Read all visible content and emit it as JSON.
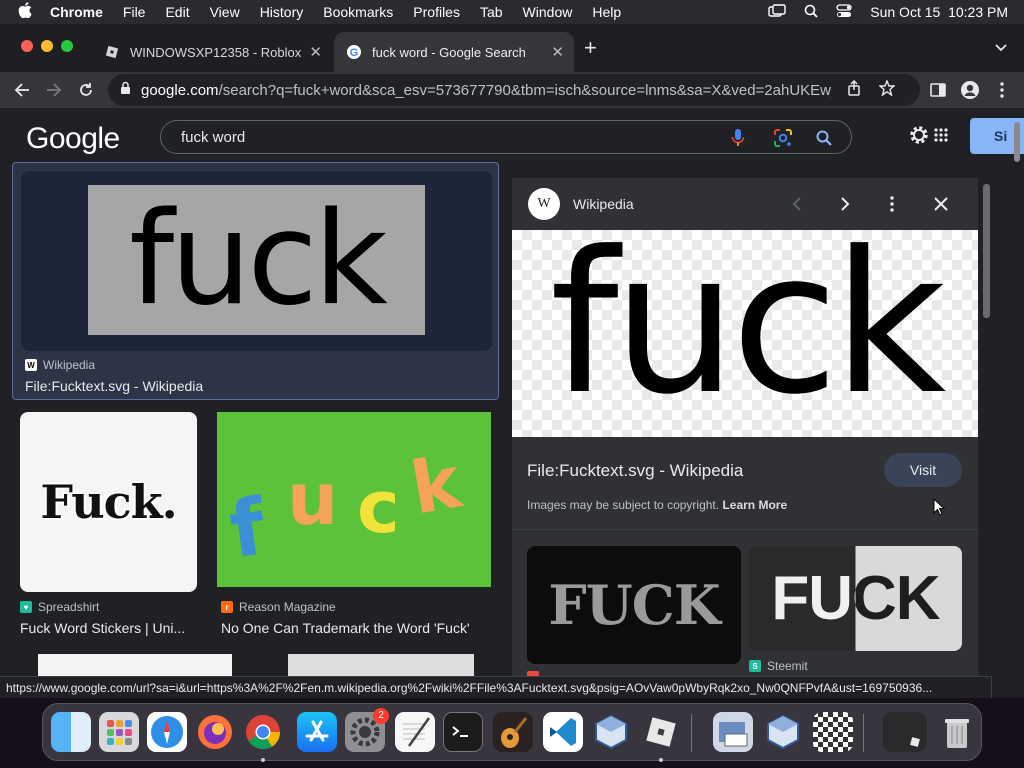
{
  "menubar": {
    "app_name": "Chrome",
    "items": [
      "File",
      "Edit",
      "View",
      "History",
      "Bookmarks",
      "Profiles",
      "Tab",
      "Window",
      "Help"
    ],
    "datetime": "Sun Oct 15  10:23 PM"
  },
  "tabs": [
    {
      "title": "WINDOWSXP12358 - Roblox",
      "active": false
    },
    {
      "title": "fuck word - Google Search",
      "active": true
    }
  ],
  "toolbar": {
    "url_host": "google.com",
    "url_path": "/search?q=fuck+word&sca_esv=573677790&tbm=isch&source=lnms&sa=X&ved=2ahUKEwj..."
  },
  "google": {
    "logo": "Google",
    "query": "fuck word",
    "signin_label": "Si"
  },
  "results": [
    {
      "image_text": "fuck",
      "source": "Wikipedia",
      "title": "File:Fucktext.svg - Wikipedia"
    },
    {
      "image_text": "Fuck.",
      "source": "Spreadshirt",
      "title": "Fuck Word Stickers | Uni..."
    },
    {
      "image_text": "fuck",
      "source": "Reason Magazine",
      "title": "No One Can Trademark the Word 'Fuck'"
    }
  ],
  "panel": {
    "source": "Wikipedia",
    "source_badge": "W",
    "image_text": "fuck",
    "title": "File:Fucktext.svg - Wikipedia",
    "visit_label": "Visit",
    "copyright_text": "Images may be subject to copyright.",
    "learn_more": "Learn More",
    "related": [
      {
        "image_text": "FUCK",
        "source": ""
      },
      {
        "image_text": "FUCK",
        "source": "Steemit"
      }
    ]
  },
  "status_url": "https://www.google.com/url?sa=i&url=https%3A%2F%2Fen.m.wikipedia.org%2Fwiki%2FFile%3AFucktext.svg&psig=AOvVaw0pWbyRqk2xo_Nw0QNFPvfA&ust=169750936...",
  "dock": {
    "settings_badge": "2",
    "apps": [
      "finder-icon",
      "launchpad-icon",
      "safari-icon",
      "firefox-icon",
      "chrome-icon",
      "app-store-icon",
      "system-settings-icon",
      "textedit-icon",
      "terminal-icon",
      "garageband-icon",
      "vscode-icon",
      "virtualbox-icon",
      "roblox-icon",
      "preview-icon",
      "virtualbox-vm-icon",
      "chess-icon",
      "window-thumbnail-icon",
      "trash-icon"
    ]
  }
}
